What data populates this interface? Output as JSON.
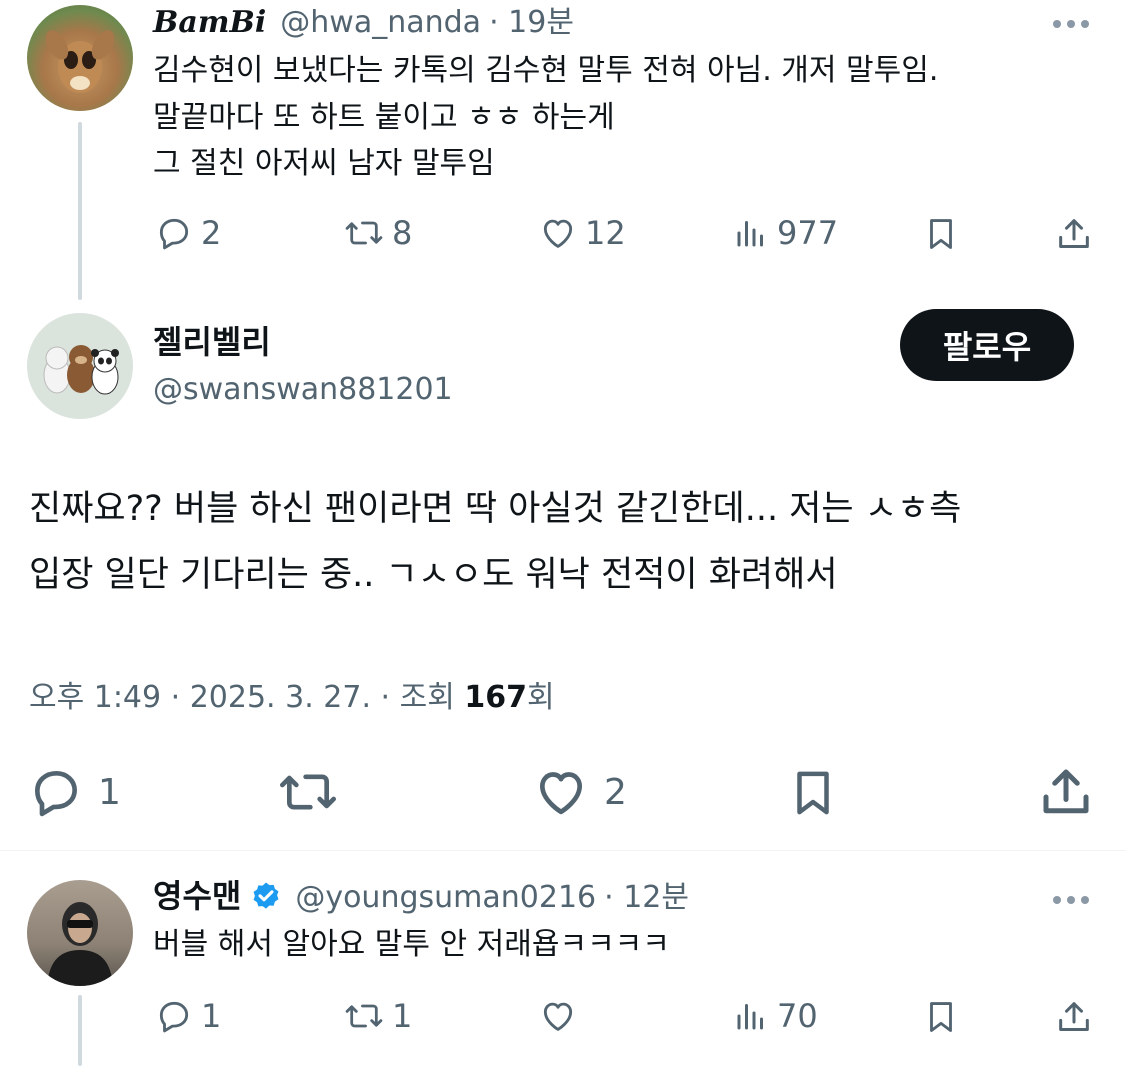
{
  "tweet1": {
    "display_name": "BamBi",
    "handle": "@hwa_nanda",
    "time": "· 19분",
    "lines": [
      "김수현이 보냈다는 카톡의 김수현 말투 전혀 아님. 개저 말투임.",
      "말끝마다 또 하트 붙이고 ㅎㅎ 하는게",
      "그 절친 아저씨 남자 말투임"
    ],
    "replies": "2",
    "retweets": "8",
    "likes": "12",
    "views": "977"
  },
  "main": {
    "display_name": "젤리벨리",
    "handle": "@swanswan881201",
    "follow_label": "팔로우",
    "lines": [
      "진짜요?? 버블 하신 팬이라면 딱 아실것 같긴한데... 저는 ㅅㅎ측",
      "입장 일단 기다리는 중.. ㄱㅅㅇ도 워낙 전적이 화려해서"
    ],
    "meta_time": "오후 1:49 · 2025. 3. 27. · 조회 ",
    "meta_views": "167",
    "meta_views_suffix": "회",
    "replies": "1",
    "likes": "2"
  },
  "tweet3": {
    "display_name": "영수맨",
    "handle": "@youngsuman0216",
    "time": "· 12분",
    "text": "버블 해서 알아요 말투 안 저래욥ㅋㅋㅋㅋ",
    "replies": "1",
    "retweets": "1",
    "views": "70"
  },
  "colors": {
    "text": "#0f1419",
    "muted": "#536471",
    "verified": "#1d9bf0",
    "follow_bg": "#0f1419"
  },
  "icons": [
    "reply-icon",
    "retweet-icon",
    "like-icon",
    "views-icon",
    "bookmark-icon",
    "share-icon",
    "more-icon",
    "verified-badge-icon"
  ]
}
